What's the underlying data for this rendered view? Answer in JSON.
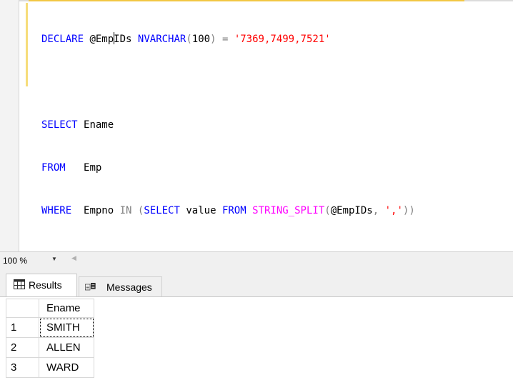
{
  "editor": {
    "line1": {
      "kw": "DECLARE",
      "var_a": "@Emp",
      "var_b": "IDs",
      "type": "NVARCHAR",
      "p_open": "(",
      "size": "100",
      "p_close": ")",
      "eq": "=",
      "literal": "'7369,7499,7521'"
    },
    "line3": {
      "kw": "SELECT",
      "col": "Ename"
    },
    "line4": {
      "kw": "FROM",
      "table": "Emp"
    },
    "line5": {
      "kw": "WHERE",
      "col": "Empno",
      "in": "IN",
      "p1": "(",
      "select": "SELECT",
      "value": "value",
      "from": "FROM",
      "fn": "STRING_SPLIT",
      "p2": "(",
      "var": "@EmpIDs",
      "comma": ",",
      "sep": "','",
      "p3": ")",
      "p4": ")"
    }
  },
  "zoom": {
    "value": "100 %"
  },
  "tabs": {
    "results": "Results",
    "messages": "Messages"
  },
  "grid": {
    "header": "Ename",
    "rows": [
      {
        "num": "1",
        "ename": "SMITH"
      },
      {
        "num": "2",
        "ename": "ALLEN"
      },
      {
        "num": "3",
        "ename": "WARD"
      }
    ]
  }
}
